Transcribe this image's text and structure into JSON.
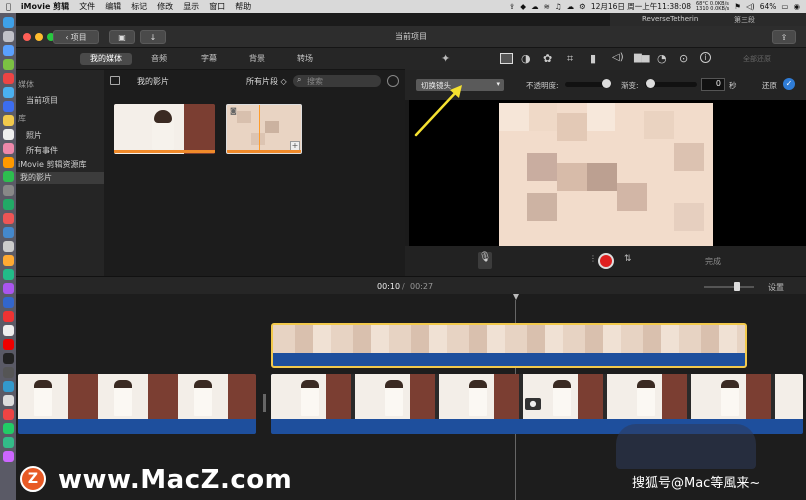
{
  "menubar": {
    "app_name": "iMovie 剪辑",
    "menus": [
      "文件",
      "编辑",
      "标记",
      "修改",
      "显示",
      "窗口",
      "帮助"
    ],
    "datetime": "12月16日 周一上午11:38:08",
    "battery": "64%",
    "net_top": "68°C 0.0KB/s",
    "net_bottom": "1310 0.0KB/s"
  },
  "toolbar": {
    "back_label": "项目",
    "title": "当前项目",
    "reverse_label": "ReverseTetherin",
    "third_label": "第三段"
  },
  "browser_tabs": [
    "我的媒体",
    "音频",
    "字幕",
    "背景",
    "转场"
  ],
  "library": {
    "section1": "媒体",
    "current_project": "当前项目",
    "section2": "库",
    "photos": "照片",
    "all_events": "所有事件",
    "resource_library": "iMovie 剪辑资源库",
    "my_movie": "我的影片"
  },
  "browser": {
    "title": "我的影片",
    "filter": "所有片段 ◇",
    "search_placeholder": "搜索"
  },
  "viewer_controls": {
    "preset": "切换镜头",
    "opacity_label": "不透明度:",
    "fade_label": "渐变:",
    "fade_value": "0",
    "fade_unit": "秒",
    "reset_label": "还原",
    "reset_all": "全部还原",
    "done_label": "完成"
  },
  "timeline": {
    "current_time": "00:10",
    "total_time": "00:27",
    "settings_label": "设置"
  },
  "watermarks": {
    "macz": "www.MacZ.com",
    "sohu": "搜狐号@Mac等風来~",
    "macz_logo_letter": "Z"
  },
  "colors": {
    "accent_blue": "#2f7cd6",
    "clip_audio_blue": "#1e4f9d",
    "selection_yellow": "#f2c94c",
    "record_red": "#e02020",
    "annotation_arrow": "#f5e130"
  }
}
